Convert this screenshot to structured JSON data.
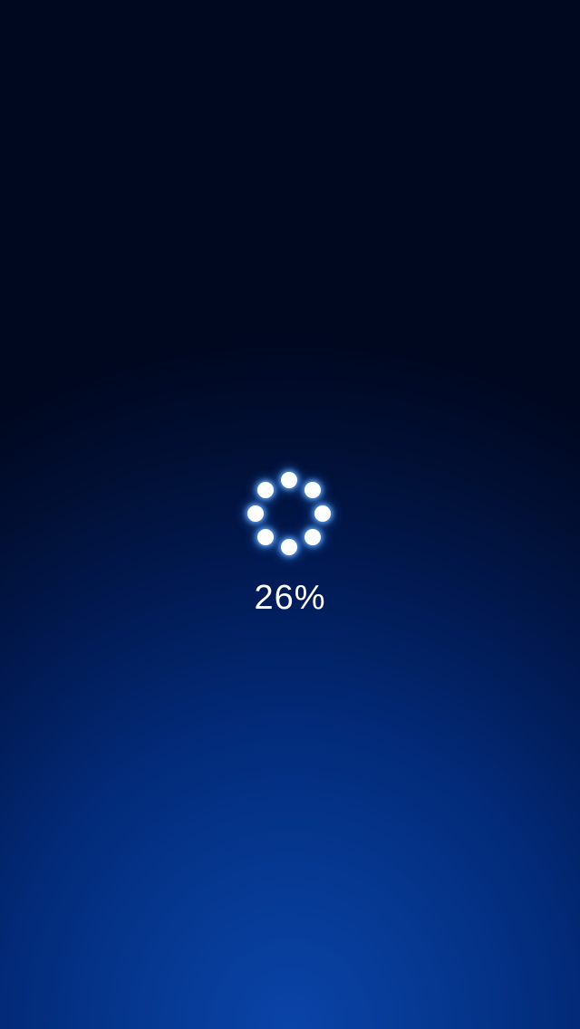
{
  "loading": {
    "progress_label": "26%",
    "progress_value": 26,
    "indicator_dot_count": 8
  },
  "colors": {
    "background_top": "#000820",
    "background_bottom": "#0a44a8",
    "dot": "#ffffff",
    "dot_glow": "#6eb4ff",
    "text": "#ffffff"
  }
}
